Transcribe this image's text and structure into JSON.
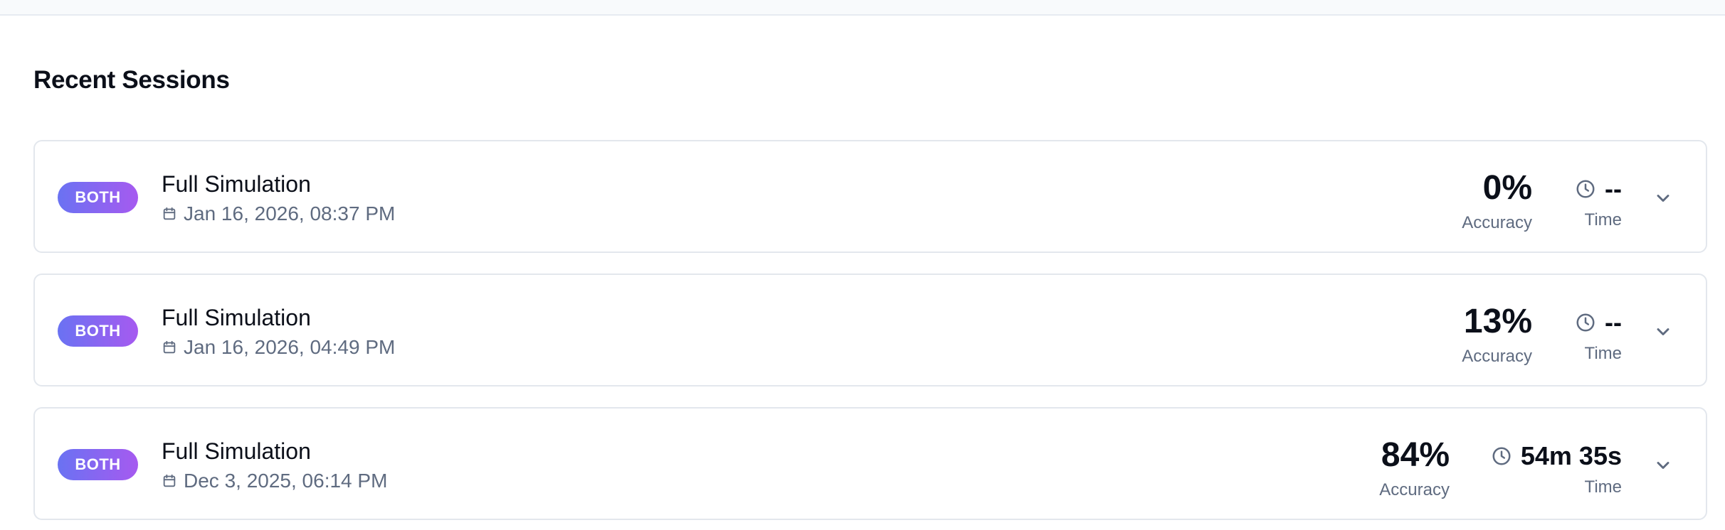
{
  "section": {
    "title": "Recent Sessions"
  },
  "sessions": [
    {
      "mode": "BOTH",
      "title": "Full Simulation",
      "date": "Jan 16, 2026, 08:37 PM",
      "accuracy": "0%",
      "accuracy_label": "Accuracy",
      "time": "--",
      "time_label": "Time",
      "icons": {
        "calendar": "calendar-icon",
        "time": "clock-icon",
        "expand": "chevron-down-icon"
      }
    },
    {
      "mode": "BOTH",
      "title": "Full Simulation",
      "date": "Jan 16, 2026, 04:49 PM",
      "accuracy": "13%",
      "accuracy_label": "Accuracy",
      "time": "--",
      "time_label": "Time",
      "icons": {
        "calendar": "calendar-icon",
        "time": "clock-icon",
        "expand": "chevron-down-icon"
      }
    },
    {
      "mode": "BOTH",
      "title": "Full Simulation",
      "date": "Dec 3, 2025, 06:14 PM",
      "accuracy": "84%",
      "accuracy_label": "Accuracy",
      "time": "54m 35s",
      "time_label": "Time",
      "icons": {
        "calendar": "calendar-icon",
        "time": "clock-icon",
        "expand": "chevron-down-icon"
      }
    }
  ],
  "colors": {
    "badge_gradient_start": "#6a72f2",
    "badge_gradient_end": "#a65af0",
    "primary_text": "#0b0f19",
    "secondary_text": "#5f6b80",
    "border": "#e3e7ed",
    "page_band": "#f8fafc"
  }
}
